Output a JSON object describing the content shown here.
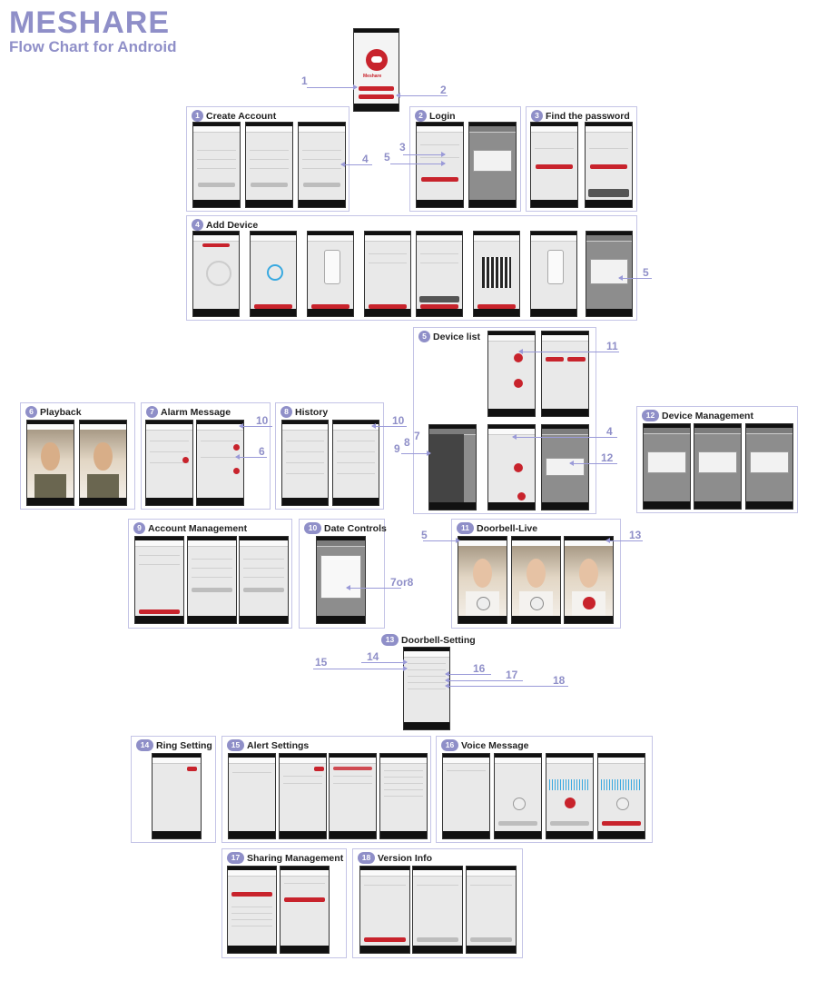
{
  "header": {
    "title": "MESHARE",
    "subtitle": "Flow Chart for Android"
  },
  "splash": {
    "logo_text": "Meshare"
  },
  "arrow_labels": {
    "to_create_account": "1",
    "to_login": "2",
    "forgot_password": "3",
    "create_to_add_device": "4",
    "login_to_live": "5",
    "add_device_done": "5",
    "menu_alarm": "7",
    "menu_history": "8",
    "menu_account": "9",
    "alarm_to_date": "10",
    "history_to_date": "10",
    "device_to_live": "11",
    "device_to_add": "4",
    "device_to_manage": "12",
    "alarm_to_playback": "6",
    "live_from_list": "5",
    "live_to_setting": "13",
    "date_back": "7or8",
    "setting_voice": "16",
    "setting_sharing": "17",
    "setting_version": "18",
    "setting_ring": "14",
    "setting_alert": "15"
  },
  "sections": [
    {
      "number": "1",
      "title": "Create Account"
    },
    {
      "number": "2",
      "title": "Login"
    },
    {
      "number": "3",
      "title": "Find the password"
    },
    {
      "number": "4",
      "title": "Add Device"
    },
    {
      "number": "5",
      "title": "Device list"
    },
    {
      "number": "6",
      "title": "Playback"
    },
    {
      "number": "7",
      "title": "Alarm Message"
    },
    {
      "number": "8",
      "title": "History"
    },
    {
      "number": "12",
      "title": "Device Management"
    },
    {
      "number": "9",
      "title": "Account Management"
    },
    {
      "number": "10",
      "title": "Date Controls"
    },
    {
      "number": "11",
      "title": "Doorbell-Live"
    },
    {
      "number": "13",
      "title": "Doorbell-Setting"
    },
    {
      "number": "14",
      "title": "Ring Setting"
    },
    {
      "number": "15",
      "title": "Alert Settings"
    },
    {
      "number": "16",
      "title": "Voice Message"
    },
    {
      "number": "17",
      "title": "Sharing Management"
    },
    {
      "number": "18",
      "title": "Version Info"
    }
  ],
  "colors": {
    "accent": "#8f8fc8",
    "brand_red": "#c8232c",
    "panel_border": "#c4c4e6"
  }
}
